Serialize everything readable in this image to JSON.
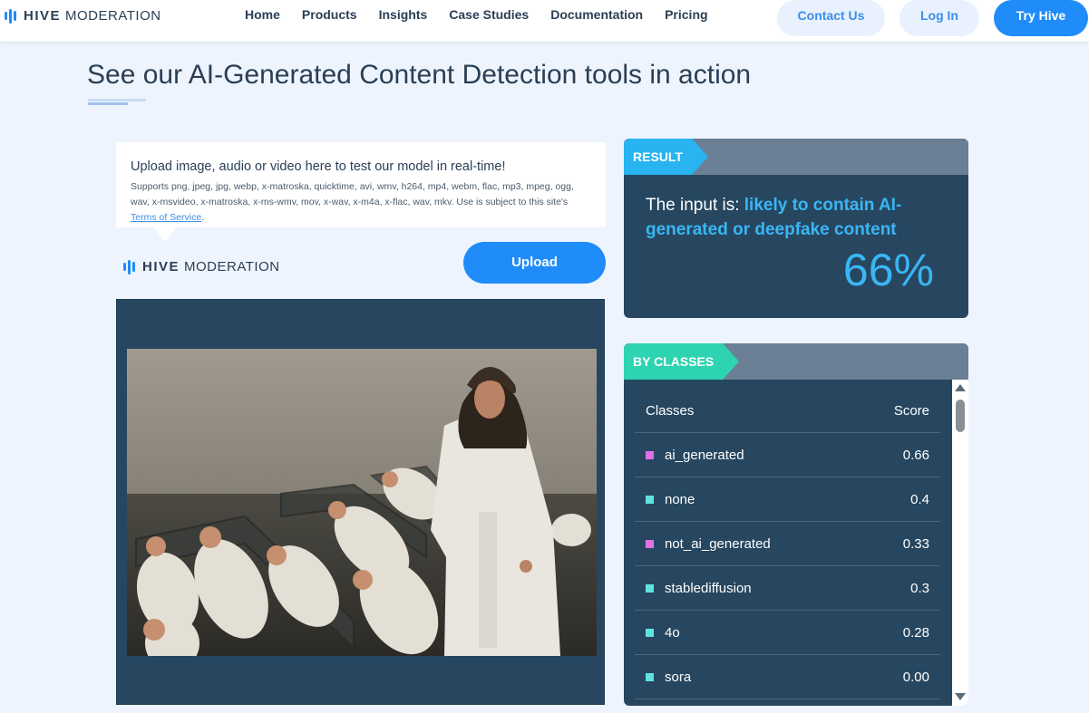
{
  "nav": {
    "logo_word": "HIVE",
    "logo_word2": "MODERATION",
    "links": [
      "Home",
      "Products",
      "Insights",
      "Case Studies",
      "Documentation",
      "Pricing"
    ],
    "contact_label": "Contact Us",
    "login_label": "Log In",
    "try_label": "Try Hive"
  },
  "page": {
    "title": "See our AI-Generated Content Detection tools in action"
  },
  "upload": {
    "prompt_title": "Upload image, audio or video here to test our model in real-time!",
    "prompt_sub": "Supports png, jpeg, jpg, webp, x-matroska, quicktime, avi, wmv, h264, mp4, webm, flac, mp3, mpeg, ogg, wav, x-msvideo, x-matroska, x-ms-wmv, mov, x-wav, x-m4a, x-flac, wav, mkv. Use is subject to this site's",
    "tos_label": "Terms of Service",
    "tos_suffix": ".",
    "button_label": "Upload"
  },
  "result": {
    "tag": "RESULT",
    "prefix": "The input is: ",
    "verdict": "likely to contain AI-generated or deepfake content",
    "percent": "66%"
  },
  "classes": {
    "tag": "BY CLASSES",
    "header_name": "Classes",
    "header_score": "Score",
    "rows": [
      {
        "name": "ai_generated",
        "score": "0.66",
        "color": "#e070e8"
      },
      {
        "name": "none",
        "score": "0.4",
        "color": "#5fe3e0"
      },
      {
        "name": "not_ai_generated",
        "score": "0.33",
        "color": "#e070e8"
      },
      {
        "name": "stablediffusion",
        "score": "0.3",
        "color": "#5fe3e0"
      },
      {
        "name": "4o",
        "score": "0.28",
        "color": "#5fe3e0"
      },
      {
        "name": "sora",
        "score": "0.00",
        "color": "#5fe3e0"
      }
    ]
  },
  "colors": {
    "accent": "#1f8cf9",
    "result_tag": "#27b4f1",
    "classes_tag": "#2ed3b1",
    "card_bg": "#274760"
  }
}
